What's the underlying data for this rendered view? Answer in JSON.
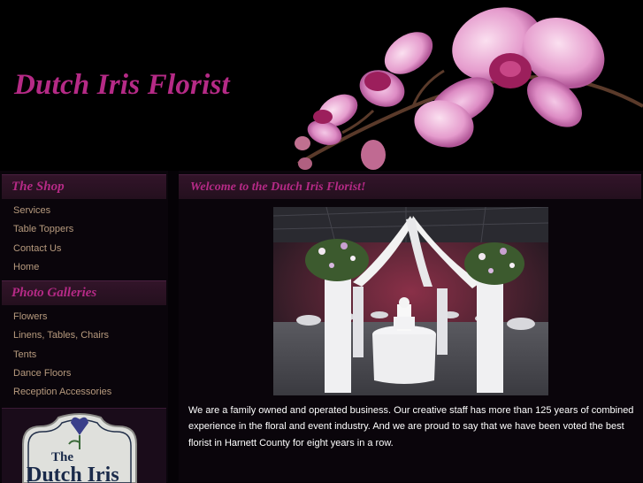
{
  "header": {
    "site_title": "Dutch Iris Florist"
  },
  "sidebar": {
    "shop_heading": "The Shop",
    "shop_items": [
      "Services",
      "Table Toppers",
      "Contact Us",
      "Home"
    ],
    "galleries_heading": "Photo Galleries",
    "gallery_items": [
      "Flowers",
      "Linens, Tables, Chairs",
      "Tents",
      "Dance Floors",
      "Reception Accessories"
    ],
    "logo_text_top": "The",
    "logo_text_main": "Dutch Iris"
  },
  "main": {
    "heading": "Welcome to the Dutch Iris Florist!",
    "intro": "We are a family owned and operated business. Our creative staff has more than 125 years of combined experience in the floral and event industry. And we are proud to say that we have been voted the best florist in Harnett County for eight years in a row."
  },
  "colors": {
    "accent": "#b52a86",
    "link": "#b79a7e",
    "panel_header": "#2b1224",
    "background": "#050206"
  }
}
